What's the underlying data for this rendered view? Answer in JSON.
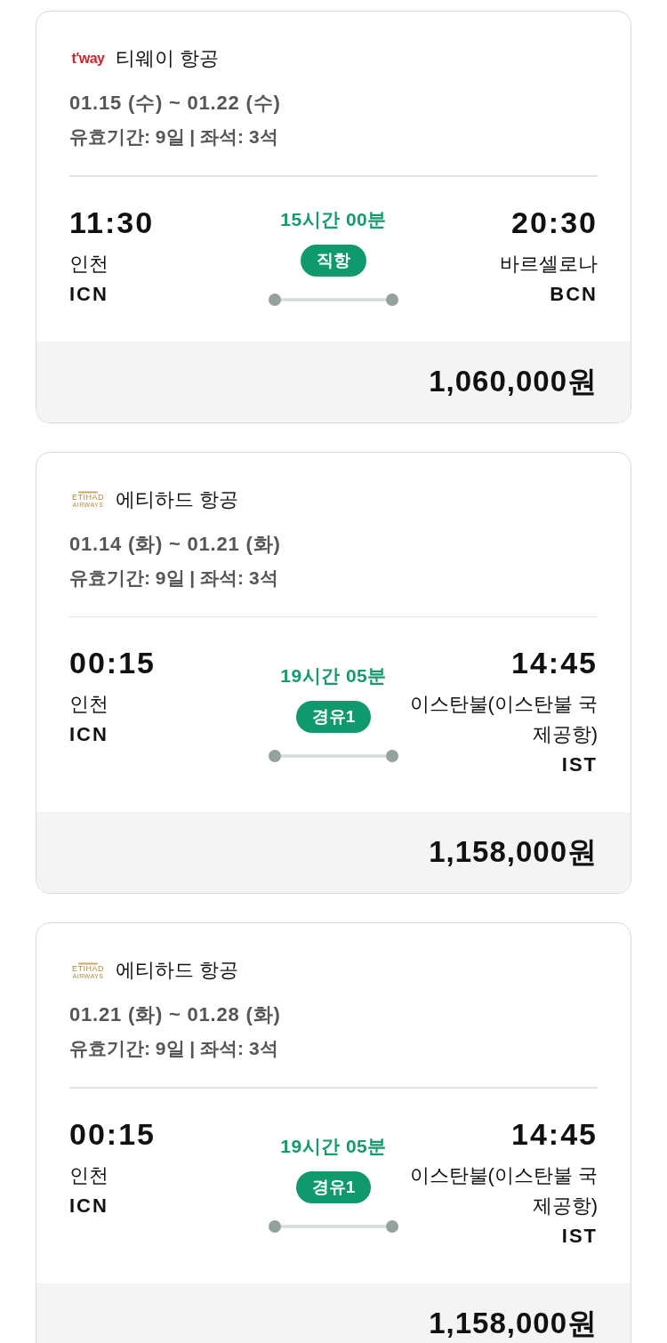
{
  "flights": [
    {
      "airline": {
        "logo": {
          "kind": "tway",
          "text": "t'way"
        },
        "name": "티웨이 항공"
      },
      "dates": "01.15 (수) ~ 01.22 (수)",
      "details": "유효기간: 9일 | 좌석: 3석",
      "departure": {
        "time": "11:30",
        "city": "인천",
        "code": "ICN"
      },
      "duration": "15시간 00분",
      "route_badge": "직항",
      "arrival": {
        "time": "20:30",
        "city": "바르셀로나",
        "code": "BCN"
      },
      "price": "1,060,000원"
    },
    {
      "airline": {
        "logo": {
          "kind": "etihad",
          "text": "ETIHAD",
          "subtext": "AIRWAYS"
        },
        "name": "에티하드 항공"
      },
      "dates": "01.14 (화) ~ 01.21 (화)",
      "details": "유효기간: 9일 | 좌석: 3석",
      "departure": {
        "time": "00:15",
        "city": "인천",
        "code": "ICN"
      },
      "duration": "19시간 05분",
      "route_badge": "경유1",
      "arrival": {
        "time": "14:45",
        "city": "이스탄불(이스탄불 국제공항)",
        "code": "IST"
      },
      "price": "1,158,000원"
    },
    {
      "airline": {
        "logo": {
          "kind": "etihad",
          "text": "ETIHAD",
          "subtext": "AIRWAYS"
        },
        "name": "에티하드 항공"
      },
      "dates": "01.21 (화) ~ 01.28 (화)",
      "details": "유효기간: 9일 | 좌석: 3석",
      "departure": {
        "time": "00:15",
        "city": "인천",
        "code": "ICN"
      },
      "duration": "19시간 05분",
      "route_badge": "경유1",
      "arrival": {
        "time": "14:45",
        "city": "이스탄불(이스탄불 국제공항)",
        "code": "IST"
      },
      "price": "1,158,000원"
    }
  ]
}
